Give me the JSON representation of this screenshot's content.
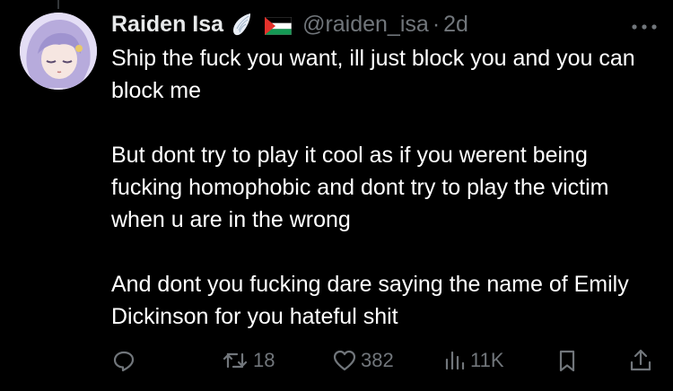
{
  "tweet": {
    "display_name": "Raiden Isa",
    "handle": "@raiden_isa",
    "separator": "·",
    "time": "2d",
    "text": [
      "Ship the fuck you want, ill just block you and you can block me",
      "But dont try to play it cool as if you werent being fucking homophobic and dont try to play the victim when u are in the wrong",
      "And dont you fucking dare saying the name of Emily Dickinson for you hateful shit"
    ]
  },
  "icons": {
    "name_emoji_1": "wing-icon",
    "name_emoji_2": "palestine-flag-icon",
    "more": "more-horizontal-icon",
    "reply": "reply-icon",
    "retweet": "retweet-icon",
    "like": "heart-icon",
    "views": "views-icon",
    "bookmark": "bookmark-icon",
    "share": "share-icon"
  },
  "actions": {
    "retweet_count": "18",
    "like_count": "382",
    "views_count": "11K"
  },
  "colors": {
    "background": "#000000",
    "text": "#ffffff",
    "secondary": "#71767b"
  }
}
